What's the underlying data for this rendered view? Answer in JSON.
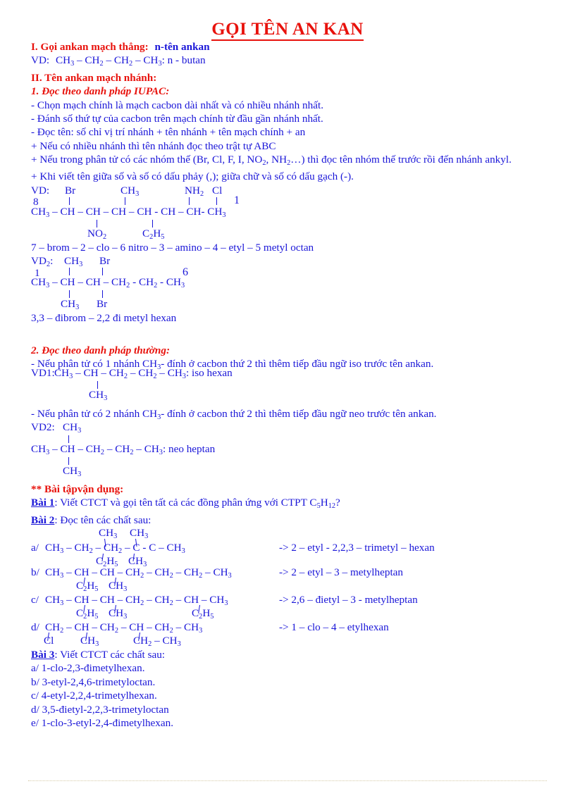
{
  "document": {
    "title": "GỌI TÊN AN KAN",
    "colors": {
      "heading_red": "#e8120c",
      "body_blue": "#1a16d8",
      "answer_green": "#0a7a18"
    }
  },
  "section_1": {
    "heading_red": "I. Gọi ankan mạch thẳng:",
    "heading_blue": "n-tên ankan",
    "example_label": "VD:",
    "example_formula": "CH3 – CH2 – CH2 – CH3",
    "example_name": ": n - butan"
  },
  "section_2": {
    "heading": "II. Tên ankan mạch nhánh:",
    "sub1_heading": "1. Đọc theo danh pháp IUPAC:",
    "rules": [
      "- Chọn mạch chính  là mạch cacbon dài nhất và có nhiều  nhánh  nhất.",
      "- Đánh số thứ tự của cacbon trên mạch chính  từ đầu gần nhánh  nhất.",
      "- Đọc tên:  số chỉ vị trí nhánh  + tên nhánh  + tên mạch chính  + an",
      "+ Nếu có nhiều  nhánh  thì  tên nhánh  đọc theo trật tự ABC",
      "+ Nếu trong phân tử có các nhóm  thế (Br, Cl, F, I, NO2, NH2…) thì  đọc tên nhóm  thế trước rồi đến nhánh  ankyl.",
      "+ Khi viết  tên giữa số và số có dấu phảy (,); giữa chữ và số có dấu gạch (-)."
    ]
  },
  "example_vd1": {
    "label": "VD:",
    "top_substituents": [
      "Br",
      "CH3",
      "NH2",
      "Cl"
    ],
    "left_number": "8",
    "right_number": "1",
    "main_chain": "CH3 – CH – CH – CH – CH  - CH – CH- CH3",
    "bottom_substituents": [
      "NO2",
      "C2H5"
    ],
    "name": "7 – brom – 2 – clo – 6 nitro  – 3 – amino  – 4 – etyl – 5 metyl  octan"
  },
  "example_vd2": {
    "label": "VD2:",
    "top_substituents": [
      "CH3",
      "Br"
    ],
    "left_number": "1",
    "right_number": "6",
    "main_chain": "CH3 – CH – CH – CH2  - CH2 - CH3",
    "bottom_substituents": [
      "CH3",
      "Br"
    ],
    "name": "3,3 – đibrom – 2,2 đi metyl  hexan"
  },
  "section_common": {
    "heading": "2. Đọc theo danh pháp thường:",
    "rule_iso": "- Nếu phân tử có 1 nhánh  CH3- đính  ở cacbon thứ 2 thì  thêm  tiếp  đầu ngữ iso  trước tên ankan.",
    "vd1_label": "VD1:",
    "vd1_chain": "CH3 – CH – CH2 – CH2 – CH3",
    "vd1_name": ": iso  hexan",
    "vd1_branch": "CH3",
    "rule_neo": "- Nếu phân tử có 2 nhánh  CH3- đính  ở cacbon thứ 2 thì  thêm  tiếp  đầu ngữ neo  trước tên ankan.",
    "vd2_label": "VD2:",
    "vd2_top": "CH3",
    "vd2_chain": "CH3 – CH – CH2 – CH2 – CH3",
    "vd2_name": ": neo  heptan",
    "vd2_bottom": "CH3"
  },
  "exercises": {
    "heading": "** Bài tậpvận  dụng:",
    "bai1": {
      "label": "Bài 1",
      "text": ": Viết CTCT và gọi tên tất cả các đồng phân ứng với  CTPT  C5H12?"
    },
    "bai2": {
      "label": "Bài 2",
      "text": ": Đọc tên các chất sau:",
      "items": [
        {
          "id": "a/",
          "chain": "CH3 – CH2 – CH2 – C  -  C – CH3",
          "top": [
            "CH3",
            "CH3"
          ],
          "bottom": [
            "C2H5",
            "CH3"
          ],
          "answer": "-> 2 – etyl - 2,2,3 – trimetyl  – hexan"
        },
        {
          "id": "b/",
          "chain": "CH3 – CH –  CH – CH2 – CH2 – CH2 – CH3",
          "bottom": [
            "C2H5",
            "CH3"
          ],
          "answer": "-> 2 – etyl – 3 – metylheptan"
        },
        {
          "id": "c/",
          "chain": "CH3 – CH –  CH – CH2 – CH2 – CH – CH3",
          "bottom": [
            "C2H5",
            "CH3",
            "C2H5"
          ],
          "answer": "-> 2,6 – đietyl  – 3 - metylheptan"
        },
        {
          "id": "d/",
          "chain": "CH2 –  CH – CH2 – CH – CH2 – CH3",
          "bottom": [
            "Cl",
            "CH3",
            "CH2 – CH3"
          ],
          "answer": "-> 1 – clo – 4 – etylhexan"
        }
      ]
    },
    "bai3": {
      "label": "Bài 3",
      "text": ": Viết CTCT các chất sau:",
      "items": [
        "a/ 1-clo-2,3-đimetylhexan.",
        "b/ 3-etyl-2,4,6-trimetyloctan.",
        "c/ 4-etyl-2,2,4-trimetylhexan.",
        "d/ 3,5-đietyl-2,2,3-trimetyloctan",
        "e/ 1-clo-3-etyl-2,4-đimetylhexan."
      ]
    }
  }
}
